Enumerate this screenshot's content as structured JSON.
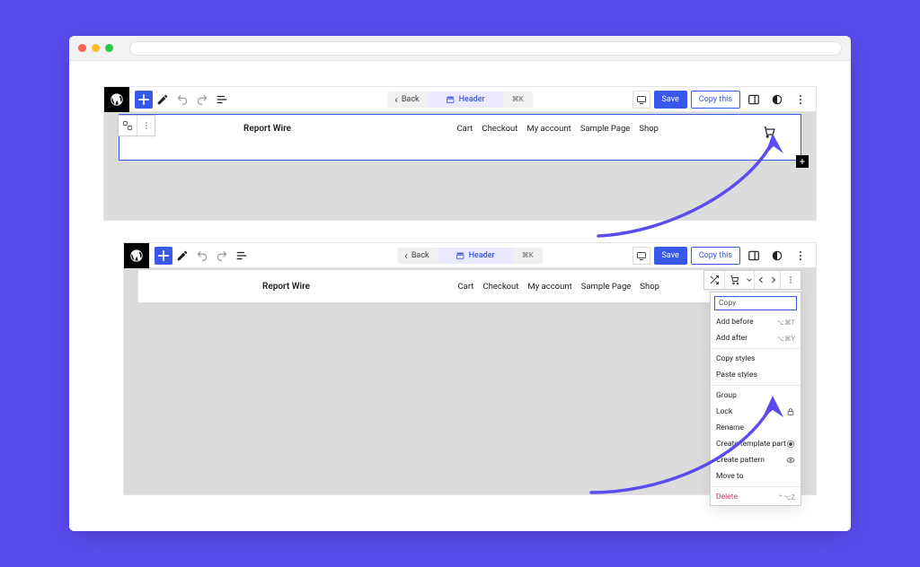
{
  "toolbar": {
    "back_label": "Back",
    "header_label": "Header",
    "kbd_hint": "⌘K",
    "save_label": "Save",
    "copy_label": "Copy this"
  },
  "site": {
    "title": "Report Wire"
  },
  "nav": {
    "items": [
      "Cart",
      "Checkout",
      "My account",
      "Sample Page",
      "Shop"
    ]
  },
  "dropdown": {
    "search_placeholder": "Copy",
    "add_before": "Add before",
    "add_before_kbd": "⌥⌘T",
    "add_after": "Add after",
    "add_after_kbd": "⌥⌘Y",
    "copy_styles": "Copy styles",
    "paste_styles": "Paste styles",
    "group": "Group",
    "lock": "Lock",
    "rename": "Rename",
    "create_template": "Create template part",
    "create_pattern": "Create pattern",
    "move_to": "Move to",
    "delete": "Delete",
    "delete_kbd": "⌃⌥Z"
  }
}
